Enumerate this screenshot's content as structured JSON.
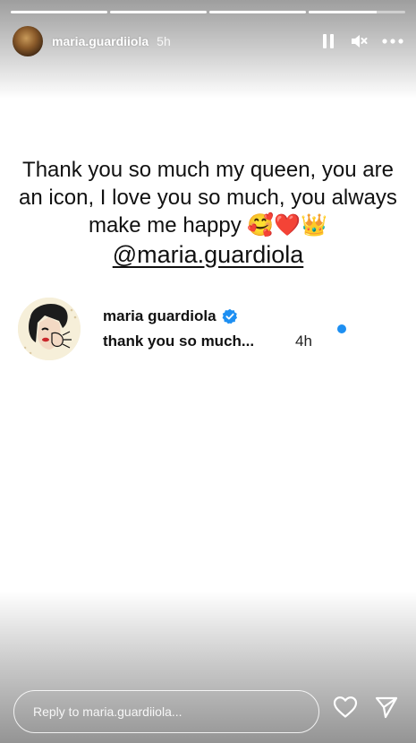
{
  "story": {
    "progress_segments": [
      1,
      1,
      1,
      1
    ],
    "progress_fill": [
      1.0,
      1.0,
      1.0,
      0.7
    ]
  },
  "header": {
    "username": "maria.guardiiola",
    "time": "5h",
    "icons": [
      "pause-icon",
      "mute-icon",
      "more-icon"
    ]
  },
  "caption": {
    "line1": "Thank you so much my queen, you are",
    "line2": "an icon, I love you so much, you always",
    "line3": "make me happy",
    "emojis": "🥰❤️👑",
    "mention": "@maria.guardiola"
  },
  "card": {
    "name": "maria guardiola",
    "verified": true,
    "text": "thank you so much...",
    "time": "4h",
    "unread_color": "#1d8ff2"
  },
  "reply": {
    "placeholder": "Reply to maria.guardiiola...",
    "icons": [
      "heart-icon",
      "send-icon"
    ]
  }
}
